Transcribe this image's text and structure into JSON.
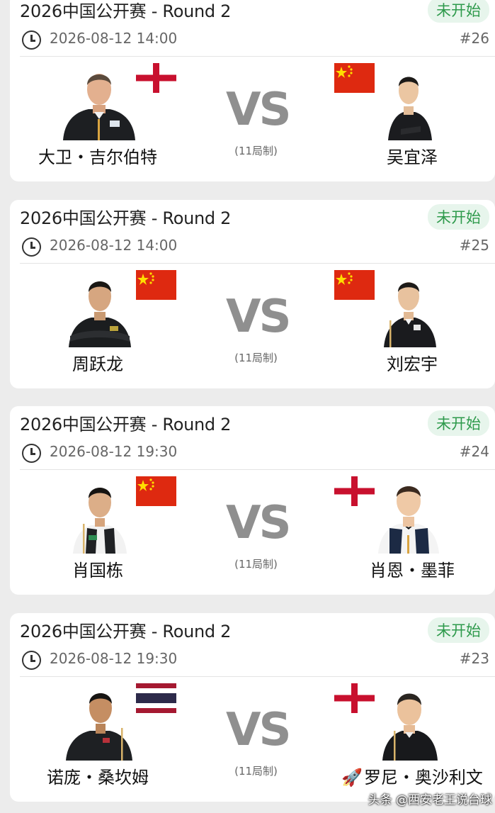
{
  "matches": [
    {
      "title": "2026中国公开赛 - Round 2",
      "status": "未开始",
      "time": "2026-08-12 14:00",
      "number": "#26",
      "vs": "VS",
      "format": "(11局制)",
      "left": {
        "name": "大卫・吉尔伯特",
        "flag": "england-flag"
      },
      "right": {
        "name": "吴宜泽",
        "flag": "china-flag"
      }
    },
    {
      "title": "2026中国公开赛 - Round 2",
      "status": "未开始",
      "time": "2026-08-12 14:00",
      "number": "#25",
      "vs": "VS",
      "format": "(11局制)",
      "left": {
        "name": "周跃龙",
        "flag": "china-flag"
      },
      "right": {
        "name": "刘宏宇",
        "flag": "china-flag"
      }
    },
    {
      "title": "2026中国公开赛 - Round 2",
      "status": "未开始",
      "time": "2026-08-12 19:30",
      "number": "#24",
      "vs": "VS",
      "format": "(11局制)",
      "left": {
        "name": "肖国栋",
        "flag": "china-flag"
      },
      "right": {
        "name": "肖恩・墨菲",
        "flag": "england-flag"
      }
    },
    {
      "title": "2026中国公开赛 - Round 2",
      "status": "未开始",
      "time": "2026-08-12 19:30",
      "number": "#23",
      "vs": "VS",
      "format": "(11局制)",
      "left": {
        "name": "诺庞・桑坎姆",
        "flag": "thailand-flag"
      },
      "right": {
        "name": "罗尼・奥沙利文",
        "flag": "england-flag",
        "prefix_icon": "rocket-icon"
      }
    }
  ],
  "colors": {
    "status_text": "#2e9a4c",
    "status_bg": "#e7f5ec",
    "vs_text": "#8f8f8f",
    "page_bg": "#ececec"
  },
  "watermark": "头条 @西安老王说台球"
}
